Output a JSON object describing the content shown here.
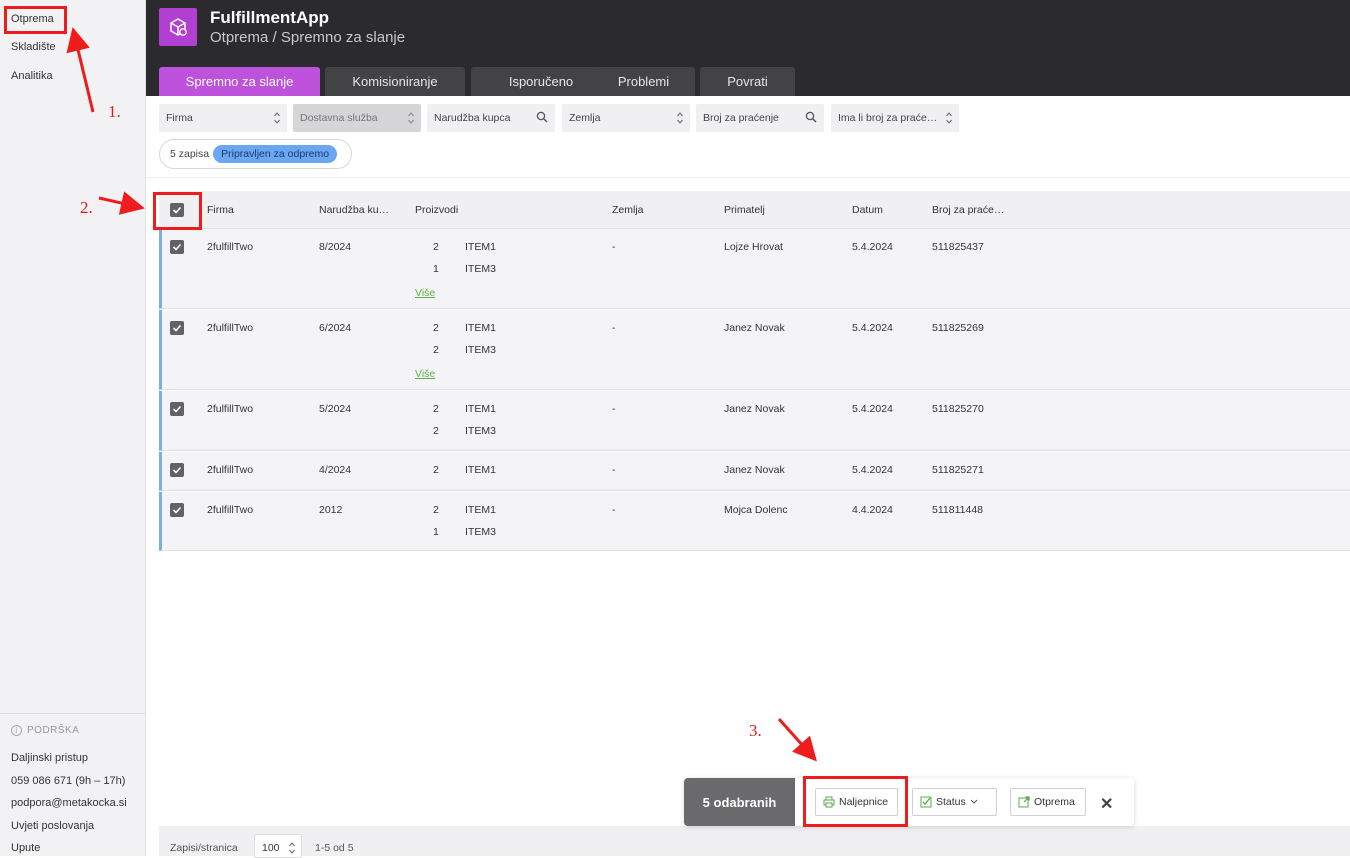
{
  "sidebar": {
    "nav": [
      "Otprema",
      "Skladište",
      "Analitika"
    ],
    "support_title": "PODRŠKA",
    "support_lines": [
      "Daljinski pristup",
      "059 086 671 (9h – 17h)",
      "podpora@metakocka.si",
      "Uvjeti poslovanja",
      "Upute"
    ]
  },
  "header": {
    "title": "FulfillmentApp",
    "subtitle": "Otprema / Spremno za slanje",
    "logo_icon": "box-icon",
    "accent": "#bf52dd"
  },
  "tabs": [
    "Spremno za slanje",
    "Komisioniranje",
    "Isporučeno",
    "Problemi",
    "Povrati"
  ],
  "filters": [
    "Firma",
    "Dostavna služba",
    "Narudžba kupca",
    "Zemlja",
    "Broj za praćenje",
    "Ima li broj za praće…"
  ],
  "status_filter": {
    "count_text": "5 zapisa",
    "badge": "Pripravljen za odpremo"
  },
  "table": {
    "headers": [
      "Firma",
      "Narudžba ku…",
      "Proizvodi",
      "Zemlja",
      "Primatelj",
      "Datum",
      "Broj za praće…"
    ],
    "more_label": "Više",
    "rows": [
      {
        "firma": "2fulfillTwo",
        "narudzba": "8/2024",
        "products": [
          {
            "qty": "2",
            "name": "ITEM1"
          },
          {
            "qty": "1",
            "name": "ITEM3"
          }
        ],
        "more": true,
        "zemlja": "-",
        "primatelj": "Lojze Hrovat",
        "datum": "5.4.2024",
        "broj": "511825437"
      },
      {
        "firma": "2fulfillTwo",
        "narudzba": "6/2024",
        "products": [
          {
            "qty": "2",
            "name": "ITEM1"
          },
          {
            "qty": "2",
            "name": "ITEM3"
          }
        ],
        "more": true,
        "zemlja": "-",
        "primatelj": "Janez Novak",
        "datum": "5.4.2024",
        "broj": "511825269"
      },
      {
        "firma": "2fulfillTwo",
        "narudzba": "5/2024",
        "products": [
          {
            "qty": "2",
            "name": "ITEM1"
          },
          {
            "qty": "2",
            "name": "ITEM3"
          }
        ],
        "more": false,
        "zemlja": "-",
        "primatelj": "Janez Novak",
        "datum": "5.4.2024",
        "broj": "511825270"
      },
      {
        "firma": "2fulfillTwo",
        "narudzba": "4/2024",
        "products": [
          {
            "qty": "2",
            "name": "ITEM1"
          }
        ],
        "more": false,
        "zemlja": "-",
        "primatelj": "Janez Novak",
        "datum": "5.4.2024",
        "broj": "511825271"
      },
      {
        "firma": "2fulfillTwo",
        "narudzba": "2012",
        "products": [
          {
            "qty": "2",
            "name": "ITEM1"
          },
          {
            "qty": "1",
            "name": "ITEM3"
          }
        ],
        "more": false,
        "zemlja": "-",
        "primatelj": "Mojca Dolenc",
        "datum": "4.4.2024",
        "broj": "511811448"
      }
    ]
  },
  "pagination": {
    "label": "Zapisi/stranica",
    "per_page": "100",
    "range": "1-5 od 5"
  },
  "action_bar": {
    "selected": "5 odabranih",
    "labels_btn": "Naljepnice",
    "status_btn": "Status",
    "ship_btn": "Otprema"
  },
  "annotations": {
    "step1": "1.",
    "step2": "2.",
    "step3": "3.",
    "color": "#ee1c1c"
  }
}
